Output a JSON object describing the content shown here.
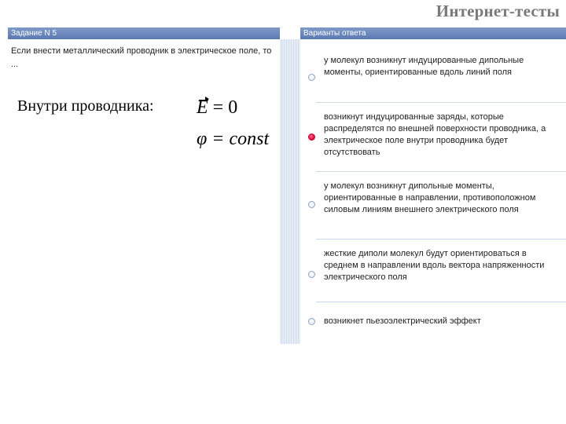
{
  "page": {
    "title": "Интернет-тесты"
  },
  "task": {
    "header": "Задание N 5",
    "question": "Если внести металлический проводник в электрическое поле, то ..."
  },
  "annotation": {
    "label": "Внутри проводника:",
    "field_symbol": "E",
    "field_equation": " = 0",
    "potential_equation": "φ = const"
  },
  "answers": {
    "header": "Варианты ответа",
    "options": [
      {
        "text": "у молекул возникнут индуцированные дипольные моменты, ориентированные вдоль линий поля",
        "selected": false
      },
      {
        "text": "возникнут индуцированные заряды, которые распределятся по внешней поверхности проводника, а электрическое поле внутри проводника будет отсутствовать",
        "selected": true
      },
      {
        "text": "у молекул возникнут дипольные моменты, ориентированные в направлении, противоположном силовым линиям внешнего электрического поля",
        "selected": false
      },
      {
        "text": "жесткие диполи молекул будут ориентироваться в среднем в направлении вдоль вектора напряженности электрического поля",
        "selected": false
      },
      {
        "text": "возникнет пьезоэлектрический эффект",
        "selected": false
      }
    ]
  },
  "colors": {
    "header_bg": "#6783bb",
    "selected_radio": "#e0003a",
    "title_gray": "#7a7a7a"
  }
}
